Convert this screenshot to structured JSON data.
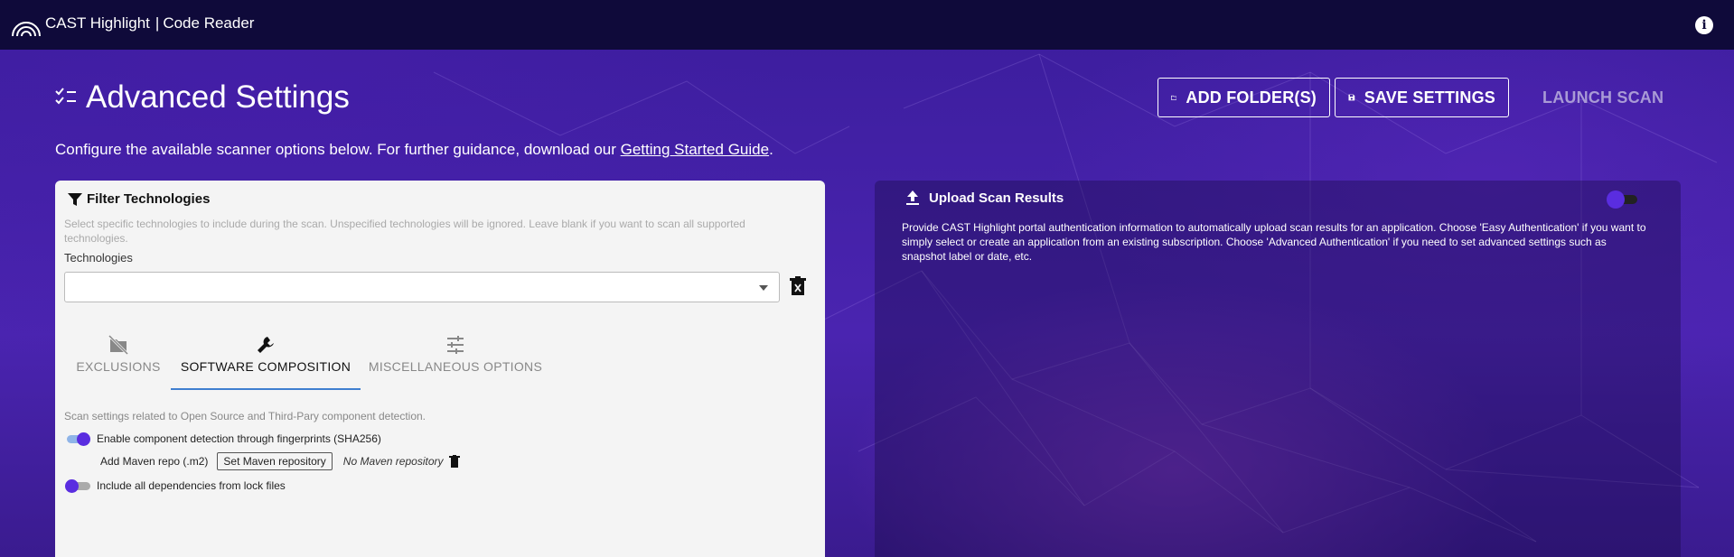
{
  "topbar": {
    "brand": "CAST Highlight",
    "separator": "|",
    "product": "Code Reader"
  },
  "header": {
    "title": "Advanced Settings",
    "subtitle_prefix": "Configure the available scanner options below. For further guidance, download our ",
    "subtitle_link": "Getting Started Guide",
    "subtitle_suffix": ".",
    "add_folders_label": "ADD FOLDER(S)",
    "save_settings_label": "SAVE SETTINGS",
    "launch_scan_label": "LAUNCH SCAN"
  },
  "filter": {
    "title": "Filter Technologies",
    "description": "Select specific technologies to include during the scan. Unspecified technologies will be ignored. Leave blank if you want to scan all supported technologies.",
    "technologies_label": "Technologies",
    "technologies_value": ""
  },
  "tabs": [
    {
      "label": "EXCLUSIONS",
      "icon": "hidden-folder-icon",
      "selected": false
    },
    {
      "label": "SOFTWARE COMPOSITION",
      "icon": "wrench-icon",
      "selected": true
    },
    {
      "label": "MISCELLANEOUS OPTIONS",
      "icon": "sliders-icon",
      "selected": false
    }
  ],
  "software": {
    "description": "Scan settings related to Open Source and Third-Pary component detection.",
    "fingerprint_label": "Enable component detection through fingerprints (SHA256)",
    "fingerprint_enabled": true,
    "maven_label": "Add Maven repo (.m2)",
    "maven_button": "Set Maven repository",
    "maven_status": "No Maven repository",
    "lock_label": "Include all dependencies from lock files",
    "lock_enabled": false
  },
  "upload": {
    "title": "Upload Scan Results",
    "description": "Provide CAST Highlight portal authentication information to automatically upload scan results for an application. Choose 'Easy Authentication' if you want to simply select or create an application from an existing subscription. Choose 'Advanced Authentication' if you need to set advanced settings such as snapshot label or date, etc.",
    "enabled": false
  },
  "colors": {
    "topbar": "#0f0a3a",
    "accent": "#5a2de0",
    "tab_underline": "#3f7fd0"
  }
}
